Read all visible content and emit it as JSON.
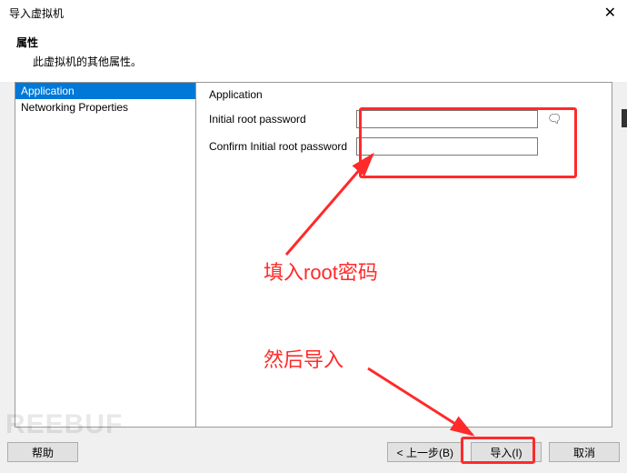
{
  "titlebar": {
    "title": "导入虚拟机"
  },
  "header": {
    "title": "属性",
    "subtitle": "此虚拟机的其他属性。"
  },
  "sidebar": {
    "items": [
      {
        "label": "Application",
        "selected": true
      },
      {
        "label": "Networking Properties",
        "selected": false
      }
    ]
  },
  "form": {
    "group_title": "Application",
    "rows": [
      {
        "label": "Initial root password",
        "value": ""
      },
      {
        "label": "Confirm Initial root password",
        "value": ""
      }
    ]
  },
  "buttons": {
    "help": "帮助",
    "back": "< 上一步(B)",
    "import": "导入(I)",
    "cancel": "取消"
  },
  "annotations": {
    "text1": "填入root密码",
    "text2": "然后导入"
  },
  "watermark": "REEBUF"
}
